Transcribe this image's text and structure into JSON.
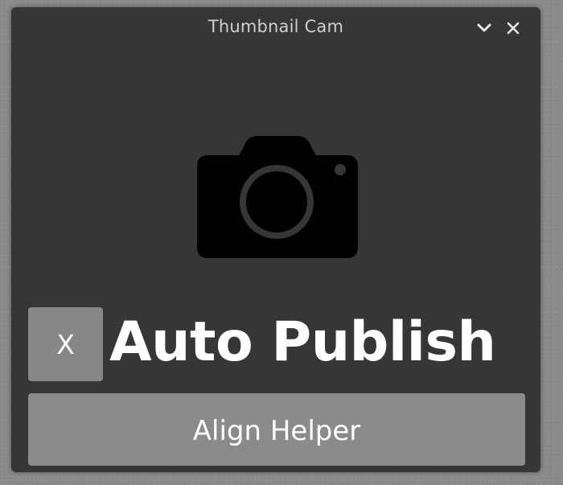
{
  "window": {
    "title": "Thumbnail Cam",
    "collapse_icon": "chevron-down-icon",
    "close_icon": "close-icon"
  },
  "main": {
    "camera_icon": "camera-icon",
    "auto_publish": {
      "checkbox_mark": "X",
      "label": "Auto Publish"
    },
    "align_button": {
      "label": "Align Helper"
    }
  },
  "colors": {
    "window_bg": "#363636",
    "button_bg": "#8b8b8b",
    "icon": "#000000",
    "text": "#ffffff",
    "title_text": "#cfcfcf"
  }
}
